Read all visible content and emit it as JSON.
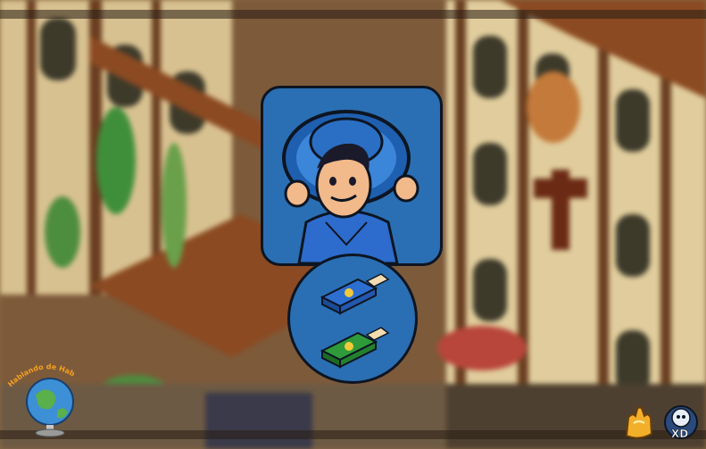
{
  "scene": {
    "description_hidden": false
  },
  "popup": {
    "avatar_icon": "mariachi-sombrero-character",
    "rewards": [
      {
        "icon": "blue-book-furni-icon",
        "color": "#2d6fd0"
      },
      {
        "icon": "green-book-furni-icon",
        "color": "#2e9a3a"
      }
    ]
  },
  "corner_left": {
    "icon": "globe-icon",
    "label": "Hablando de Habbolandia"
  },
  "corner_right": {
    "icons": [
      "golden-hand-icon",
      "xd-space-badge-icon"
    ],
    "badge_text": "XD"
  },
  "colors": {
    "panel": "#2a6fb3",
    "border": "#0d1522"
  }
}
